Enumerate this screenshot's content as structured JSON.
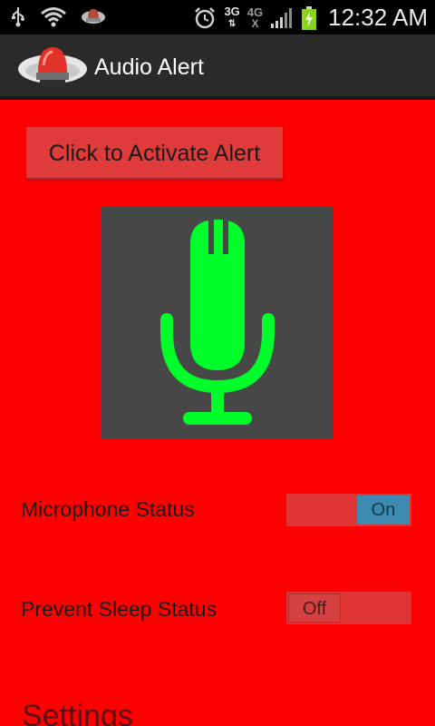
{
  "statusbar": {
    "icons": [
      "usb-icon",
      "wifi-icon",
      "app-notification-icon",
      "alarm-icon",
      "signal-icon",
      "battery-charging-icon"
    ],
    "network_3g": "3G",
    "network_4g": "4G",
    "time": "12:32 AM"
  },
  "actionbar": {
    "title": "Audio Alert",
    "logo_icon": "siren-icon"
  },
  "main": {
    "activate_button_label": "Click to Activate Alert",
    "mic_icon": "microphone-icon",
    "mic_color": "#00ff2a",
    "microphone_status": {
      "label": "Microphone Status",
      "toggle_value": "On"
    },
    "prevent_sleep_status": {
      "label": "Prevent Sleep Status",
      "toggle_value": "Off"
    },
    "settings_heading": "Settings"
  },
  "colors": {
    "background": "#ff0000",
    "actionbar": "#2a2a2a",
    "toggle_on": "#3d8bb3"
  }
}
